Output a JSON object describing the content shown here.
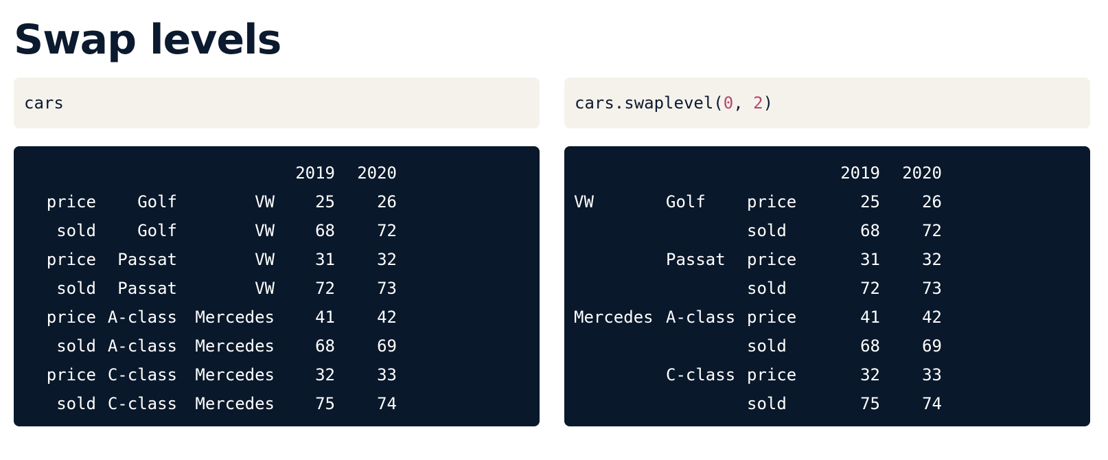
{
  "title": "Swap levels",
  "left_cell": {
    "code": "cars"
  },
  "right_cell": {
    "code_prefix": "cars.swaplevel(",
    "arg1": "0",
    "sep": ", ",
    "arg2": "2",
    "code_suffix": ")"
  },
  "left_output": {
    "columns": [
      "2019",
      "2020"
    ],
    "rows": [
      {
        "l0": "price",
        "l1": "Golf",
        "l2": "VW",
        "v2019": "25",
        "v2020": "26"
      },
      {
        "l0": "sold",
        "l1": "Golf",
        "l2": "VW",
        "v2019": "68",
        "v2020": "72"
      },
      {
        "l0": "price",
        "l1": "Passat",
        "l2": "VW",
        "v2019": "31",
        "v2020": "32"
      },
      {
        "l0": "sold",
        "l1": "Passat",
        "l2": "VW",
        "v2019": "72",
        "v2020": "73"
      },
      {
        "l0": "price",
        "l1": "A-class",
        "l2": "Mercedes",
        "v2019": "41",
        "v2020": "42"
      },
      {
        "l0": "sold",
        "l1": "A-class",
        "l2": "Mercedes",
        "v2019": "68",
        "v2020": "69"
      },
      {
        "l0": "price",
        "l1": "C-class",
        "l2": "Mercedes",
        "v2019": "32",
        "v2020": "33"
      },
      {
        "l0": "sold",
        "l1": "C-class",
        "l2": "Mercedes",
        "v2019": "75",
        "v2020": "74"
      }
    ]
  },
  "right_output": {
    "columns": [
      "2019",
      "2020"
    ],
    "rows": [
      {
        "l0": "VW",
        "l1": "Golf",
        "l2": "price",
        "v2019": "25",
        "v2020": "26"
      },
      {
        "l0": "",
        "l1": "",
        "l2": "sold",
        "v2019": "68",
        "v2020": "72"
      },
      {
        "l0": "",
        "l1": "Passat",
        "l2": "price",
        "v2019": "31",
        "v2020": "32"
      },
      {
        "l0": "",
        "l1": "",
        "l2": "sold",
        "v2019": "72",
        "v2020": "73"
      },
      {
        "l0": "Mercedes",
        "l1": "A-class",
        "l2": "price",
        "v2019": "41",
        "v2020": "42"
      },
      {
        "l0": "",
        "l1": "",
        "l2": "sold",
        "v2019": "68",
        "v2020": "69"
      },
      {
        "l0": "",
        "l1": "C-class",
        "l2": "price",
        "v2019": "32",
        "v2020": "33"
      },
      {
        "l0": "",
        "l1": "",
        "l2": "sold",
        "v2019": "75",
        "v2020": "74"
      }
    ]
  },
  "colors": {
    "title": "#0b1a2e",
    "code_background": "#f5f2ec",
    "output_background": "#0a182b",
    "number_literal": "#b5466b"
  }
}
